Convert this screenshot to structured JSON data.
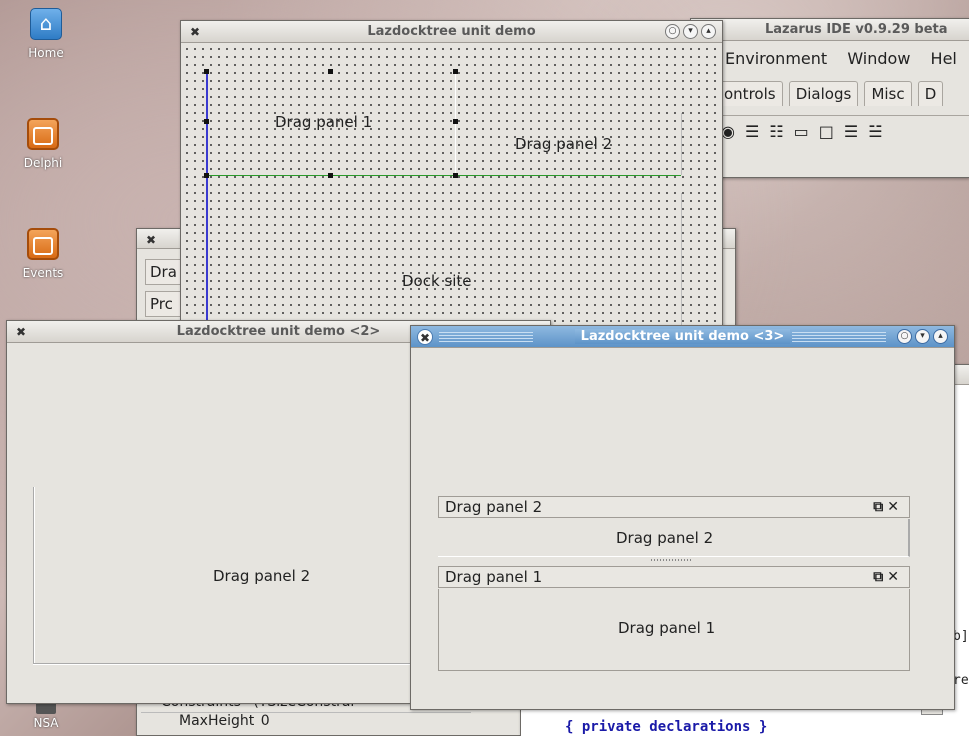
{
  "desktop": {
    "icons": [
      {
        "label": "Home",
        "icon": "home-icon"
      },
      {
        "label": "Delphi",
        "icon": "delphi-icon"
      },
      {
        "label": "Events",
        "icon": "events-icon"
      },
      {
        "label": "NSA",
        "icon": "nsa-icon"
      }
    ]
  },
  "ide": {
    "title": "Lazarus IDE v0.9.29 beta",
    "menu": [
      "Environment",
      "Window",
      "Hel"
    ],
    "tabs": [
      "ontrols",
      "Dialogs",
      "Misc",
      "D"
    ]
  },
  "design_window": {
    "title": "Lazdocktree unit demo",
    "panel1": "Drag panel 1",
    "panel2": "Drag panel 2",
    "dock_site": "Dock site"
  },
  "behind_window": {
    "tab1": "Dra",
    "tab2": "Prc",
    "constraints": "Constraints",
    "constraints_value": "(TSizeConstrai",
    "max_height_label": "MaxHeight",
    "max_height_value": "0"
  },
  "window2": {
    "title": "Lazdocktree unit demo <2>",
    "panel_label": "Drag panel 2"
  },
  "window3": {
    "title": "Lazdocktree unit demo <3>",
    "panel2_header": "Drag panel 2",
    "panel2_body": "Drag panel 2",
    "panel1_header": "Drag panel 1",
    "panel1_body": "Drag panel 1"
  },
  "editor": {
    "code_line": "{ private declarations }",
    "snippet1": "b]",
    "snippet2": "re"
  }
}
